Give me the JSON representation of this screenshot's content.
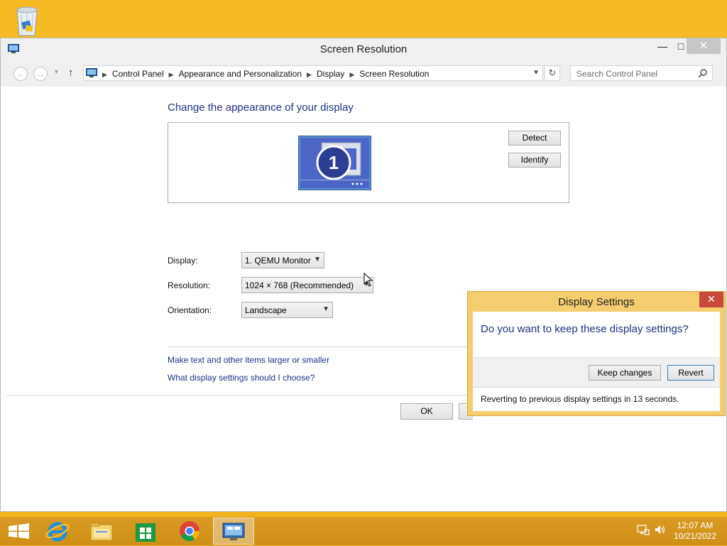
{
  "window": {
    "title": "Screen Resolution",
    "controls": {
      "minimize": "—",
      "maximize": "□",
      "close": "✕"
    }
  },
  "nav": {
    "back": "←",
    "forward": "→",
    "up": "↑",
    "breadcrumbs": [
      "Control Panel",
      "Appearance and Personalization",
      "Display",
      "Screen Resolution"
    ],
    "refresh": "↻",
    "search_placeholder": "Search Control Panel"
  },
  "main": {
    "heading": "Change the appearance of your display",
    "monitor_number": "1",
    "detect_label": "Detect",
    "identify_label": "Identify",
    "display_label": "Display:",
    "display_value": "1. QEMU Monitor",
    "resolution_label": "Resolution:",
    "resolution_value": "1024 × 768 (Recommended)",
    "orientation_label": "Orientation:",
    "orientation_value": "Landscape",
    "link_text_size": "Make text and other items larger or smaller",
    "link_help": "What display settings should I choose?",
    "ok_label": "OK"
  },
  "dialog": {
    "title": "Display Settings",
    "close": "✕",
    "question": "Do you want to keep these display settings?",
    "keep_label": "Keep changes",
    "revert_label": "Revert",
    "status": "Reverting to previous display settings in 13 seconds."
  },
  "taskbar": {
    "icons": [
      "start-icon",
      "internet-explorer-icon",
      "file-explorer-icon",
      "store-icon",
      "chrome-icon",
      "screen-resolution-icon"
    ],
    "active_index": 5,
    "time": "12:07 AM",
    "date": "10/21/2022"
  },
  "colors": {
    "desktop": "#f3b61f",
    "link_blue": "#1e3287",
    "dialog_frame": "#f5cd6e",
    "close_red": "#c74a3b"
  }
}
